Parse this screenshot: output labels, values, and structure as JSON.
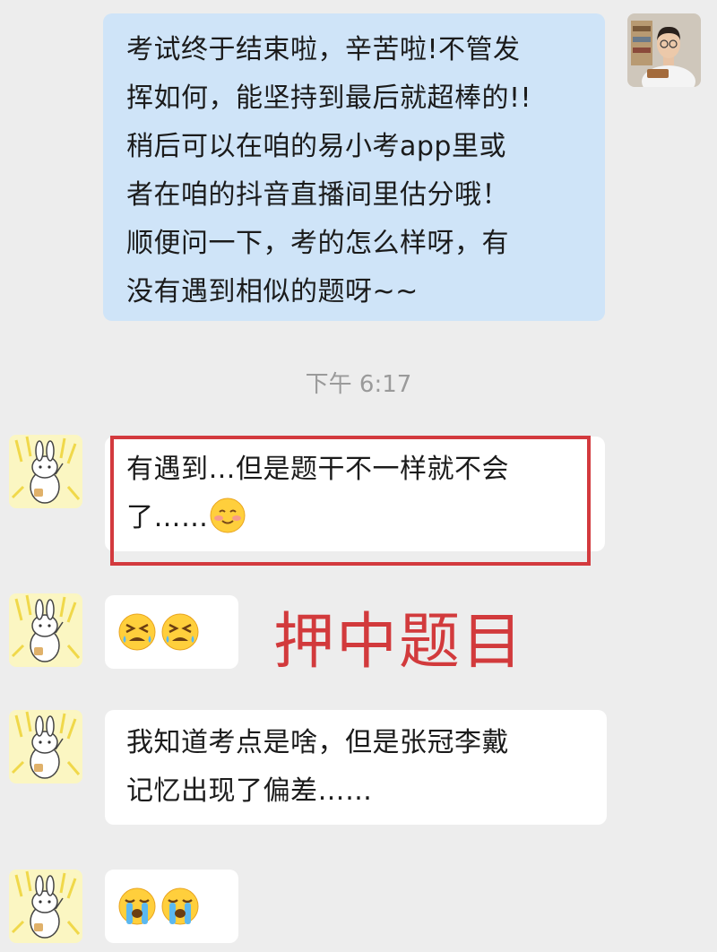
{
  "messages": [
    {
      "text": "考试终于结束啦，辛苦啦!不管发\n挥如何，能坚持到最后就超棒的!!\n稍后可以在咱的易小考app里或\n者在咱的抖音直播间里估分哦！\n顺便问一下，考的怎么样呀，有\n没有遇到相似的题呀~~"
    },
    {
      "text": "有遇到…但是题干不一样就不会\n了……"
    },
    {
      "text": "我知道考点是啥，但是张冠李戴\n记忆出现了偏差……"
    }
  ],
  "timestamp": "下午 6:17",
  "annotation": "押中题目",
  "icons": {
    "teacher_avatar": "teacher-portrait",
    "student_avatar": "bunny-sticker",
    "emoji_blush": "smiling-face-with-blush",
    "emoji_tired": "tired-face",
    "emoji_crying": "loudly-crying-face"
  },
  "colors": {
    "outgoing_bubble": "#cfe4f8",
    "incoming_bubble": "#ffffff",
    "highlight": "#d33a3e",
    "background": "#ededed"
  }
}
